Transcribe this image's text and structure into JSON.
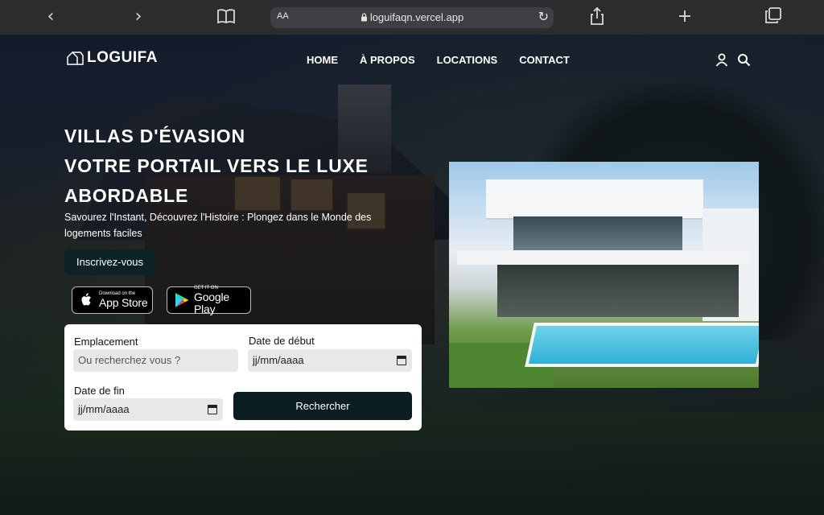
{
  "browser": {
    "aa_label": "AA",
    "url": "loguifaqn.vercel.app",
    "back_icon": "chevron-left-icon",
    "forward_icon": "chevron-right-icon",
    "reader_icon": "book-icon",
    "reload_icon": "reload-icon",
    "share_icon": "share-icon",
    "new_tab_icon": "plus-icon",
    "tabs_icon": "tabs-icon"
  },
  "nav": {
    "brand": "LOGUIFA",
    "links": [
      "HOME",
      "À PROPOS",
      "LOCATIONS",
      "CONTACT"
    ],
    "user_icon": "user-icon",
    "search_icon": "search-icon"
  },
  "hero": {
    "title_lines": [
      "VILLAS D'ÉVASION",
      "VOTRE PORTAIL VERS LE LUXE",
      "ABORDABLE"
    ],
    "subtitle": "Savourez l'Instant, Découvrez l'Histoire : Plongez dans le Monde des logements faciles",
    "cta_label": "Inscrivez-vous",
    "app_store": {
      "small": "Download on the",
      "big": "App Store"
    },
    "google_play": {
      "small": "GET IT ON",
      "big": "Google Play"
    }
  },
  "form": {
    "location_label": "Emplacement",
    "location_placeholder": "Ou recherchez vous ?",
    "start_label": "Date de début",
    "start_value": "jj/mm/aaaa",
    "end_label": "Date de fin",
    "end_value": "jj/mm/aaaa",
    "search_label": "Rechercher"
  },
  "colors": {
    "accent_dark": "#0c1d22",
    "browser_chrome": "#2a2c2e"
  }
}
